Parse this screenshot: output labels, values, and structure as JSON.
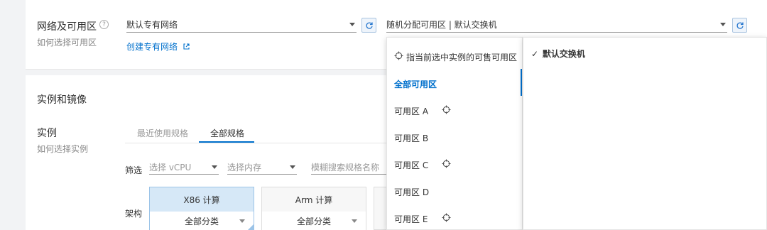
{
  "network": {
    "title": "网络及可用区",
    "help_icon": "?",
    "subtitle": "如何选择可用区",
    "vpc_value": "默认专有网络",
    "create_vpc_link": "创建专有网络",
    "zone_value": "随机分配可用区 | 默认交换机"
  },
  "instance": {
    "section_title": "实例和镜像",
    "label": "实例",
    "subtitle": "如何选择实例",
    "tabs": [
      {
        "label": "最近使用规格",
        "active": false
      },
      {
        "label": "全部规格",
        "active": true
      }
    ],
    "filter_label": "筛选",
    "vcpu_placeholder": "选择 vCPU",
    "memory_placeholder": "选择内存",
    "search_placeholder": "模糊搜索规格名称",
    "arch_label": "架构",
    "arch_options": [
      {
        "label": "X86 计算",
        "category": "全部分类",
        "active": true
      },
      {
        "label": "Arm 计算",
        "category": "全部分类",
        "active": false
      }
    ]
  },
  "zone_menu": {
    "header": "指当前选中实例的可售可用区",
    "items": [
      {
        "label": "全部可用区",
        "active": true,
        "crosshair": false
      },
      {
        "label": "可用区 A",
        "active": false,
        "crosshair": true
      },
      {
        "label": "可用区 B",
        "active": false,
        "crosshair": false
      },
      {
        "label": "可用区 C",
        "active": false,
        "crosshair": true
      },
      {
        "label": "可用区 D",
        "active": false,
        "crosshair": false
      },
      {
        "label": "可用区 E",
        "active": false,
        "crosshair": true
      }
    ]
  },
  "switch_menu": {
    "check": "✓",
    "item": "默认交换机"
  },
  "colors": {
    "accent": "#0070cc",
    "active_arch_bg": "#d6e8f7"
  }
}
